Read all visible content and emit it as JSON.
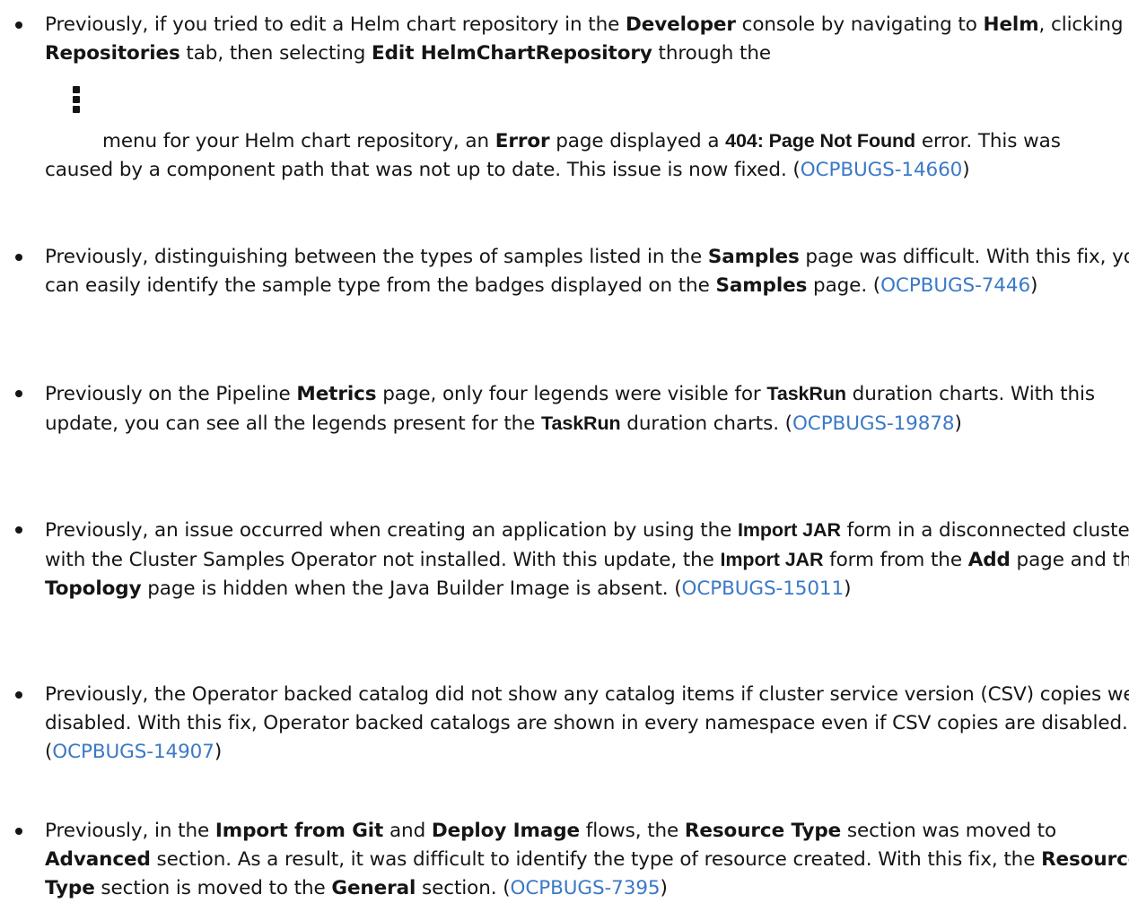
{
  "items": [
    {
      "p1": "Previously, if you tried to edit a Helm chart repository in the ",
      "b1": "Developer",
      "p2": " console by navigating to ",
      "b2": "Helm",
      "p3": ", clicking the ",
      "b3": "Repositories",
      "p4": " tab, then selecting ",
      "b4": "Edit HelmChartRepository",
      "p5": " through the",
      "icon": "kebab-menu-icon",
      "p6": "menu for your Helm chart repository, an ",
      "b5": "Error",
      "p7": " page displayed a ",
      "b6": "404: Page Not Found",
      "p8": " error. This was caused by a component path that was not up to date. This issue is now fixed. (",
      "link": "OCPBUGS-14660",
      "p9": ")"
    },
    {
      "p1": "Previously, distinguishing between the types of samples listed in the ",
      "b1": "Samples",
      "p2": " page was difficult. With this fix, you can easily identify the sample type from the badges displayed on the ",
      "b2": "Samples",
      "p3": " page. (",
      "link": "OCPBUGS-7446",
      "p4": ")"
    },
    {
      "p1": "Previously on the Pipeline ",
      "b1": "Metrics",
      "p2": " page, only four legends were visible for ",
      "b2": "TaskRun",
      "p3": " duration charts. With this update, you can see all the legends present for the ",
      "b3": "TaskRun",
      "p4": " duration charts. (",
      "link": "OCPBUGS-19878",
      "p5": ")"
    },
    {
      "p1": "Previously, an issue occurred when creating an application by using the ",
      "b1": "Import JAR",
      "p2": " form in a disconnected cluster with the Cluster Samples Operator not installed. With this update, the ",
      "b2": "Import JAR",
      "p3": " form from the ",
      "b3": "Add",
      "p4": " page and the ",
      "b4": "Topology",
      "p5": " page is hidden when the Java Builder Image is absent. (",
      "link": "OCPBUGS-15011",
      "p6": ")"
    },
    {
      "p1": "Previously, the Operator backed catalog did not show any catalog items if cluster service version (CSV) copies were disabled. With this fix, Operator backed catalogs are shown in every namespace even if CSV copies are disabled. (",
      "link": "OCPBUGS-14907",
      "p2": ")"
    },
    {
      "p1": "Previously, in the ",
      "b1": "Import from Git",
      "p2": " and ",
      "b2": "Deploy Image",
      "p3": " flows, the ",
      "b3": "Resource Type",
      "p4": " section was moved to ",
      "b4": "Advanced",
      "p5": " section. As a result, it was difficult to identify the type of resource created. With this fix, the ",
      "b5": "Resource Type",
      "p6": " section is moved to the ",
      "b6": "General",
      "p7": " section. (",
      "link": "OCPBUGS-7395",
      "p8": ")"
    }
  ]
}
